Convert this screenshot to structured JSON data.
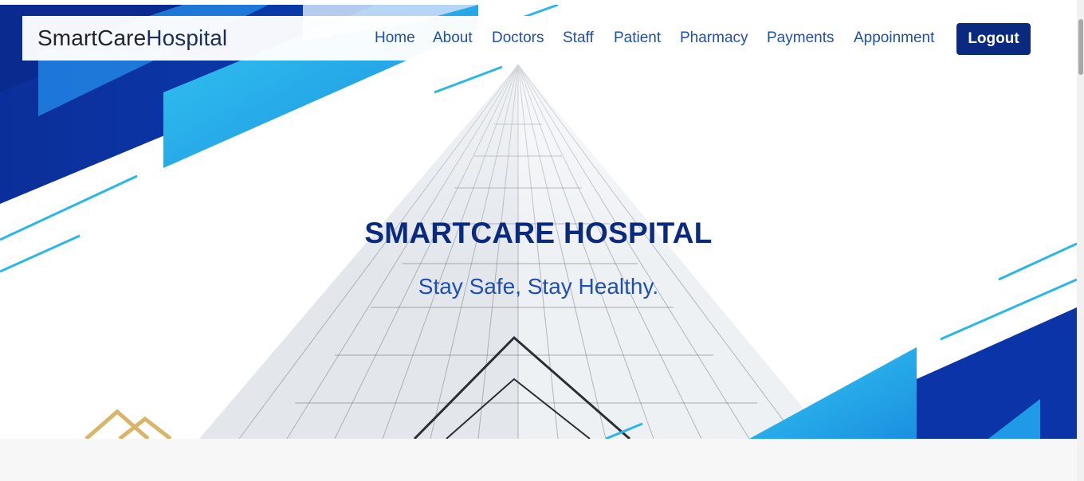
{
  "brand": {
    "part1": "SmartCare",
    "part2": "Hospital"
  },
  "nav": {
    "items": [
      {
        "label": "Home"
      },
      {
        "label": "About"
      },
      {
        "label": "Doctors"
      },
      {
        "label": "Staff"
      },
      {
        "label": "Patient"
      },
      {
        "label": "Pharmacy"
      },
      {
        "label": "Payments"
      },
      {
        "label": "Appoinment"
      }
    ],
    "logout_label": "Logout"
  },
  "hero": {
    "title": "SMARTCARE HOSPITAL",
    "subtitle": "Stay Safe, Stay Healthy."
  },
  "colors": {
    "primary_dark": "#0a2a80",
    "link_blue": "#1f4fb0",
    "accent_cyan": "#2bb6ea",
    "gold": "#d9b56a"
  }
}
